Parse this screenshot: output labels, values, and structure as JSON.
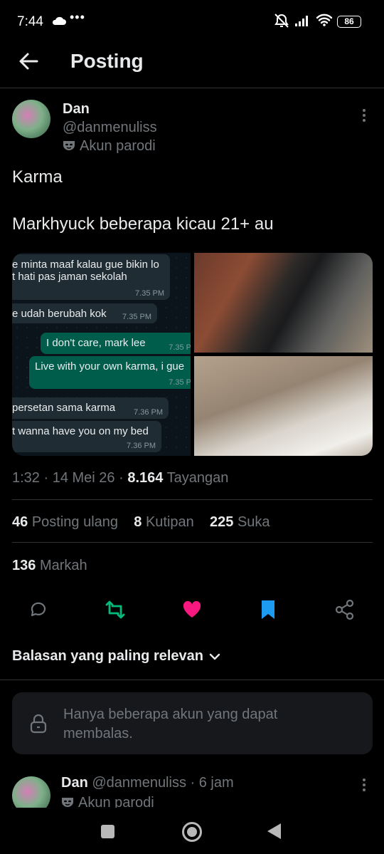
{
  "status_bar": {
    "time": "7:44",
    "dots": "•••",
    "battery": "86"
  },
  "header": {
    "title": "Posting"
  },
  "author": {
    "name": "Dan",
    "handle": "@danmenuliss",
    "badge": "Akun parodi"
  },
  "tweet": {
    "lines": [
      "Karma",
      "Markhyuck beberapa kicau 21+ au"
    ]
  },
  "chat": [
    {
      "dir": "in",
      "text": "e minta maaf kalau gue bikin lo",
      "text2": "t hati pas jaman sekolah",
      "time": "7.35 PM"
    },
    {
      "dir": "in",
      "text": "e udah berubah kok",
      "time": "7.35 PM"
    },
    {
      "dir": "out",
      "text": "I don't care, mark lee",
      "time": "7.35 P"
    },
    {
      "dir": "out",
      "text": "Live with your own karma, i gue",
      "time": "7.35 P"
    },
    {
      "dir": "in",
      "text": "persetan sama karma",
      "time": "7.36 PM"
    },
    {
      "dir": "in",
      "text": "t wanna have you on my bed",
      "time": "7.36 PM"
    }
  ],
  "meta": {
    "time": "1:32",
    "date": "14 Mei 26",
    "views": "8.164",
    "views_label": "Tayangan"
  },
  "stats": {
    "reposts": "46",
    "reposts_label": "Posting ulang",
    "quotes": "8",
    "quotes_label": "Kutipan",
    "likes": "225",
    "likes_label": "Suka",
    "bookmarks": "136",
    "bookmarks_label": "Markah"
  },
  "colors": {
    "repost": "#00ba7c",
    "like": "#f91880",
    "bookmark": "#1d9bf0",
    "muted": "#71767b"
  },
  "replies": {
    "sort_label": "Balasan yang paling relevan",
    "restricted_msg": "Hanya beberapa akun yang dapat membalas."
  },
  "reply": {
    "name": "Dan",
    "handle": "@danmenuliss",
    "sep": "·",
    "age": "6 jam",
    "badge": "Akun parodi"
  }
}
